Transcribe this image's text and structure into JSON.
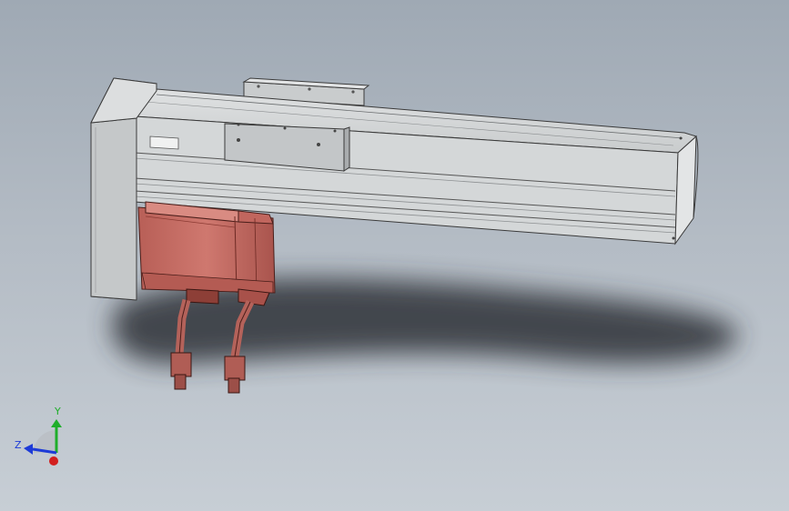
{
  "viewport": {
    "background_top": "#9fa9b4",
    "background_bottom": "#c7ced5"
  },
  "model": {
    "rail_color": "#cdd0d2",
    "motor_color": "#c36a62",
    "shadow_color": "#2e3338"
  },
  "triad": {
    "y_label": "Y",
    "z_label": "Z",
    "y_color": "#1fae2a",
    "z_color": "#1d3bd8",
    "x_color": "#d21f1f"
  }
}
